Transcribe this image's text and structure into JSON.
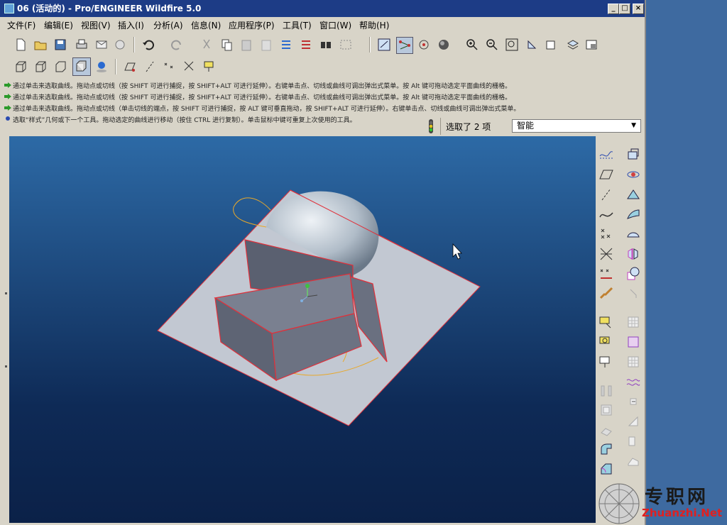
{
  "window": {
    "title": "06 (活动的) - Pro/ENGINEER Wildfire 5.0",
    "controls": [
      "_",
      "□",
      "×"
    ]
  },
  "menu": [
    "文件(F)",
    "编辑(E)",
    "视图(V)",
    "插入(I)",
    "分析(A)",
    "信息(N)",
    "应用程序(P)",
    "工具(T)",
    "窗口(W)",
    "帮助(H)"
  ],
  "messages": [
    "通过单击来选取曲线。拖动点或切线（按 SHIFT 可进行捕捉，按 SHIFT+ALT 可进行延伸）。右键单击点、切线或曲线可调出弹出式菜单。按 Alt 键可拖动选定平面曲线的栅格。",
    "通过单击来选取曲线。拖动点或切线（按 SHIFT 可进行捕捉，按 SHIFT+ALT 可进行延伸）。右键单击点、切线或曲线可调出弹出式菜单。按 Alt 键可拖动选定平面曲线的栅格。",
    "通过单击来选取曲线。拖动点或切线（单击切线的端点，按 SHIFT 可进行捕捉，按 ALT 键可垂直拖动，按 SHIFT+ALT 可进行延伸）。右键单击点、切线或曲线可调出弹出式菜单。",
    "选取“样式”几何或下一个工具。拖动选定的曲线进行移动（按住 CTRL 进行复制）。单击鼠标中键可重复上次使用的工具。"
  ],
  "status": {
    "selection": "选取了 2 项",
    "filter": "智能"
  },
  "colors": {
    "titlebar": "#1d3c86",
    "viewport_top": "#2d6aa6",
    "viewport_bottom": "#0b2148",
    "edge": "#e0303a",
    "curve": "#e8a82a"
  },
  "watermark": {
    "cn": "专职网",
    "en": "Zhuanzhi.Net"
  }
}
